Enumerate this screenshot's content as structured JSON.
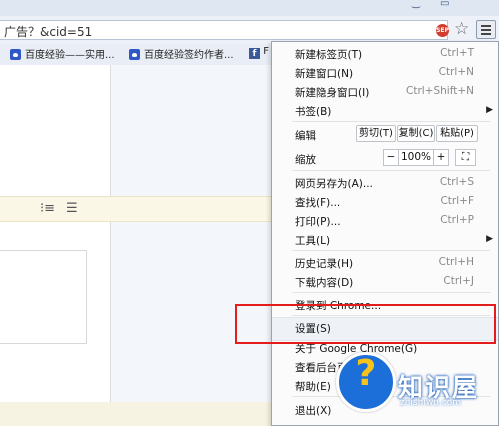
{
  "address_bar": {
    "url_text": "广告？&cid=51",
    "extension_badge": "SEP"
  },
  "bookmarks": [
    {
      "label": "百度经验——实用..."
    },
    {
      "label": "百度经验签约作者..."
    },
    {
      "label": "F"
    }
  ],
  "menu": {
    "new_tab": {
      "label": "新建标签页(T)",
      "shortcut": "Ctrl+T"
    },
    "new_window": {
      "label": "新建窗口(N)",
      "shortcut": "Ctrl+N"
    },
    "new_incognito": {
      "label": "新建隐身窗口(I)",
      "shortcut": "Ctrl+Shift+N"
    },
    "bookmarks": {
      "label": "书签(B)"
    },
    "edit": {
      "label": "编辑",
      "cut": "剪切(T)",
      "copy": "复制(C)",
      "paste": "粘贴(P)"
    },
    "zoom": {
      "label": "缩放",
      "minus": "−",
      "value": "100%",
      "plus": "+",
      "fullscreen": "⛶"
    },
    "save_as": {
      "label": "网页另存为(A)...",
      "shortcut": "Ctrl+S"
    },
    "find": {
      "label": "查找(F)...",
      "shortcut": "Ctrl+F"
    },
    "print": {
      "label": "打印(P)...",
      "shortcut": "Ctrl+P"
    },
    "tools": {
      "label": "工具(L)"
    },
    "history": {
      "label": "历史记录(H)",
      "shortcut": "Ctrl+H"
    },
    "downloads": {
      "label": "下载内容(D)",
      "shortcut": "Ctrl+J"
    },
    "sign_in": {
      "label": "登录到 Chrome..."
    },
    "settings": {
      "label": "设置(S)"
    },
    "about": {
      "label": "关于 Google Chrome(G)"
    },
    "background": {
      "label": "查看后台页面"
    },
    "help": {
      "label": "帮助(E)"
    },
    "exit": {
      "label": "退出(X)"
    }
  },
  "watermark": {
    "brand": "知识屋",
    "url": "zhishiwu.com",
    "glyph": "?"
  },
  "colors": {
    "highlight_box": "#e41c1c",
    "watermark_blue": "#1c6ed8"
  }
}
